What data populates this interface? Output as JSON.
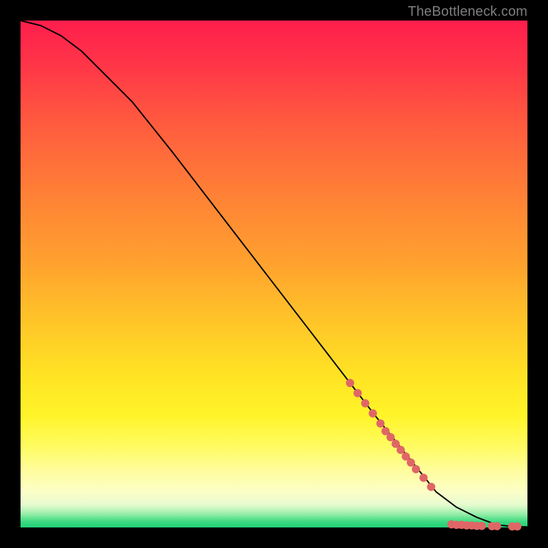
{
  "watermark": "TheBottleneck.com",
  "chart_data": {
    "type": "line",
    "title": "",
    "xlabel": "",
    "ylabel": "",
    "xlim": [
      0,
      100
    ],
    "ylim": [
      0,
      100
    ],
    "grid": false,
    "legend": false,
    "series": [
      {
        "name": "curve",
        "kind": "line",
        "color": "#000000",
        "x": [
          0,
          4,
          8,
          12,
          16,
          22,
          30,
          40,
          50,
          60,
          70,
          78,
          82,
          86,
          90,
          94,
          97,
          100
        ],
        "y": [
          100,
          99,
          97,
          94,
          90,
          84,
          74,
          61,
          48,
          35,
          22,
          12,
          7,
          4,
          2,
          0.5,
          0.2,
          0.1
        ]
      },
      {
        "name": "markers",
        "kind": "scatter",
        "color": "#E06666",
        "x": [
          65,
          66.5,
          68,
          69.5,
          71,
          72,
          73,
          74,
          75,
          76,
          77,
          78,
          79.5,
          81,
          85,
          86,
          87,
          88,
          89,
          90,
          91,
          93,
          94,
          97,
          98
        ],
        "y": [
          28.5,
          26.5,
          24.5,
          22.5,
          20.5,
          19,
          17.8,
          16.5,
          15.3,
          14,
          12.8,
          11.5,
          9.8,
          8,
          0.6,
          0.5,
          0.5,
          0.4,
          0.4,
          0.3,
          0.3,
          0.25,
          0.25,
          0.2,
          0.2
        ]
      }
    ]
  }
}
